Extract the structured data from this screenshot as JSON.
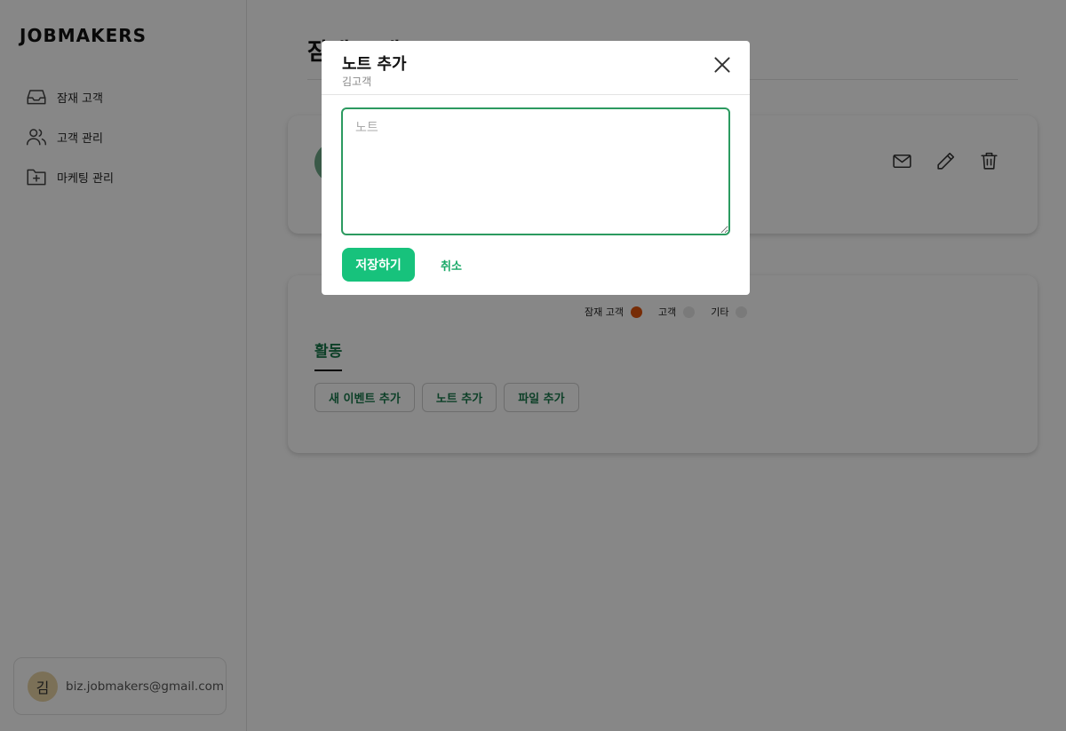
{
  "sidebar": {
    "brand": "JOBMAKERS",
    "items": [
      {
        "label": "잠재 고객",
        "icon": "inbox-icon"
      },
      {
        "label": "고객 관리",
        "icon": "users-icon"
      },
      {
        "label": "마케팅 관리",
        "icon": "folder-plus-icon"
      }
    ],
    "user": {
      "avatar_initial": "김",
      "email": "biz.jobmakers@gmail.com"
    }
  },
  "main": {
    "title": "잠재 고객",
    "profile_card": {
      "actions": [
        {
          "icon": "mail-icon"
        },
        {
          "icon": "pencil-icon"
        },
        {
          "icon": "trash-icon"
        }
      ]
    },
    "activity_card": {
      "status_options": [
        {
          "label": "잠재 고객",
          "active": true,
          "color": "#e0530d"
        },
        {
          "label": "고객",
          "active": false
        },
        {
          "label": "기타",
          "active": false
        }
      ],
      "tab_label": "활동",
      "buttons": [
        {
          "label": "새 이벤트 추가"
        },
        {
          "label": "노트 추가"
        },
        {
          "label": "파일 추가"
        }
      ]
    }
  },
  "modal": {
    "title": "노트 추가",
    "subtitle": "김고객",
    "note_placeholder": "노트",
    "note_value": "",
    "save_label": "저장하기",
    "cancel_label": "취소"
  },
  "colors": {
    "accent": "#17c27c",
    "accent_text": "#1a7a4c",
    "input_border": "#2c9a60",
    "status_active": "#e0530d"
  }
}
